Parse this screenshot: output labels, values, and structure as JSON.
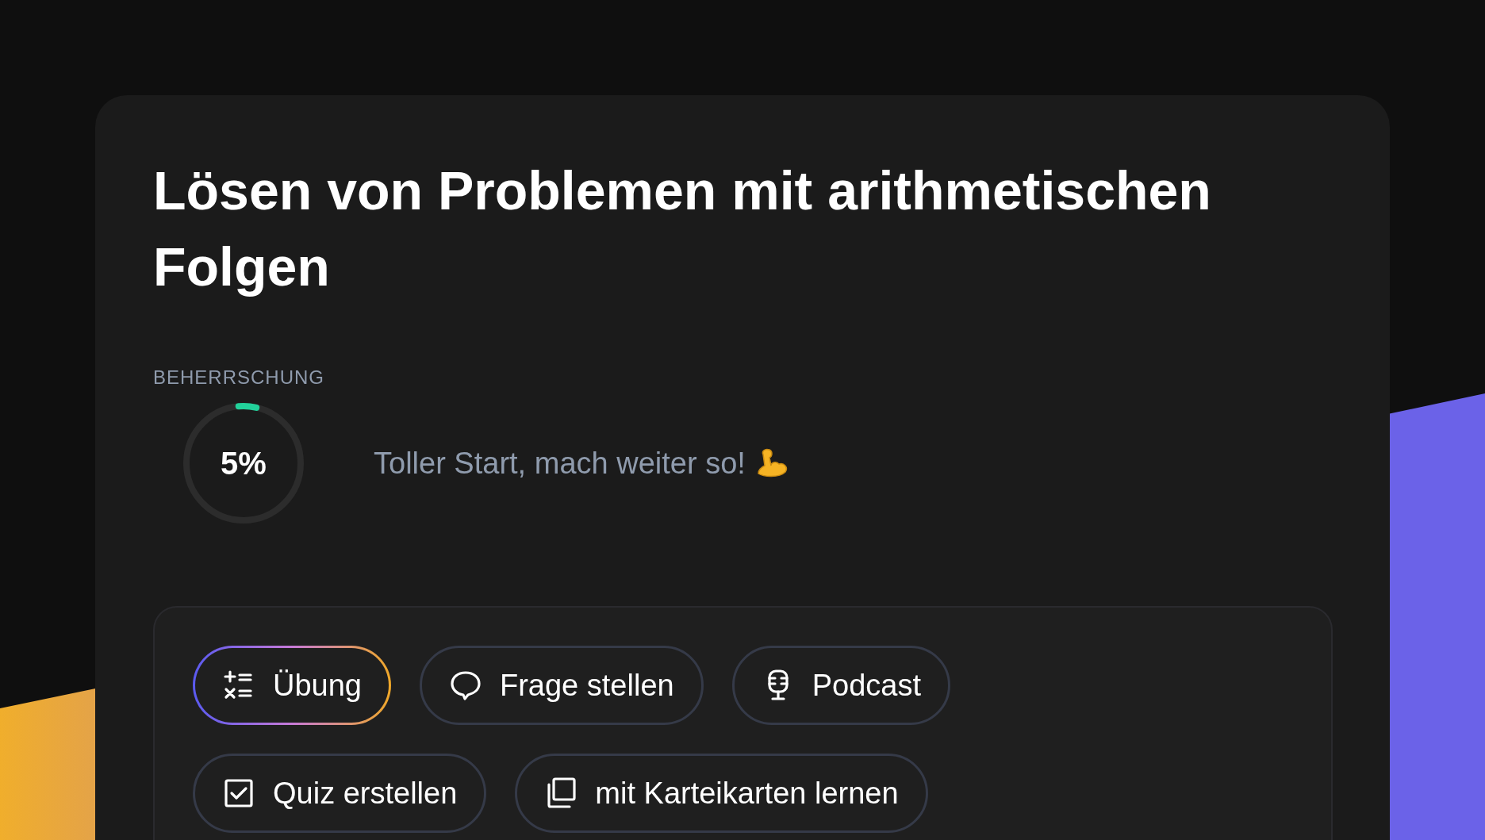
{
  "title": "Lösen von Problemen mit arithmetischen Folgen",
  "mastery": {
    "label": "BEHERRSCHUNG",
    "level": 0.05,
    "reading": "5%",
    "message": "Toller Start, mach weiter so!"
  },
  "actions": [
    {
      "label": "Übung",
      "kind": "practice",
      "selected": true
    },
    {
      "label": "Frage stellen",
      "kind": "ask",
      "selected": false
    },
    {
      "label": "Podcast",
      "kind": "podcast",
      "selected": false
    },
    {
      "label": "Quiz erstellen",
      "kind": "quiz",
      "selected": false
    },
    {
      "label": "mit Karteikarten lernen",
      "kind": "flashcards",
      "selected": false
    }
  ]
}
